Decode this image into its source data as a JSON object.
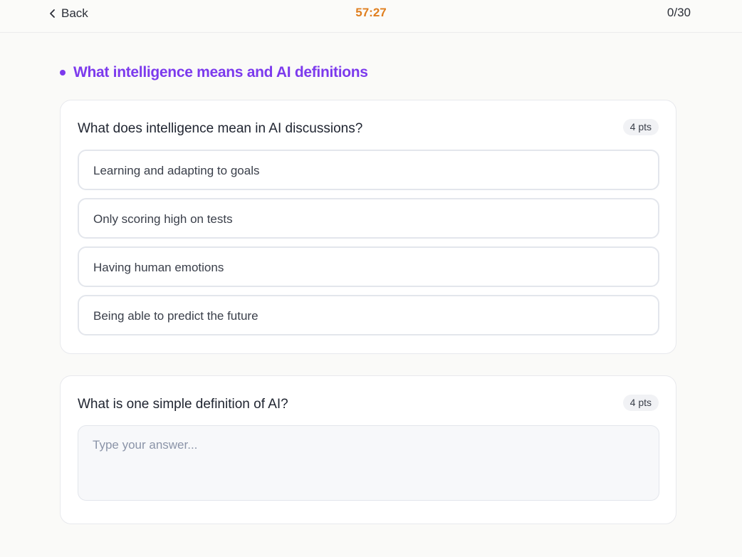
{
  "header": {
    "back_label": "Back",
    "timer": "57:27",
    "progress": "0/30"
  },
  "section": {
    "title": "What intelligence means and AI definitions",
    "accent_color": "#7c3aed"
  },
  "questions": [
    {
      "text": "What does intelligence mean in AI discussions?",
      "points": "4 pts",
      "options": [
        "Learning and adapting to goals",
        "Only scoring high on tests",
        "Having human emotions",
        "Being able to predict the future"
      ]
    },
    {
      "text": "What is one simple definition of AI?",
      "points": "4 pts",
      "answer_value": "",
      "answer_placeholder": "Type your answer..."
    }
  ],
  "icons": {
    "back": "chevron-left-icon"
  },
  "colors": {
    "timer": "#e07f1f"
  }
}
